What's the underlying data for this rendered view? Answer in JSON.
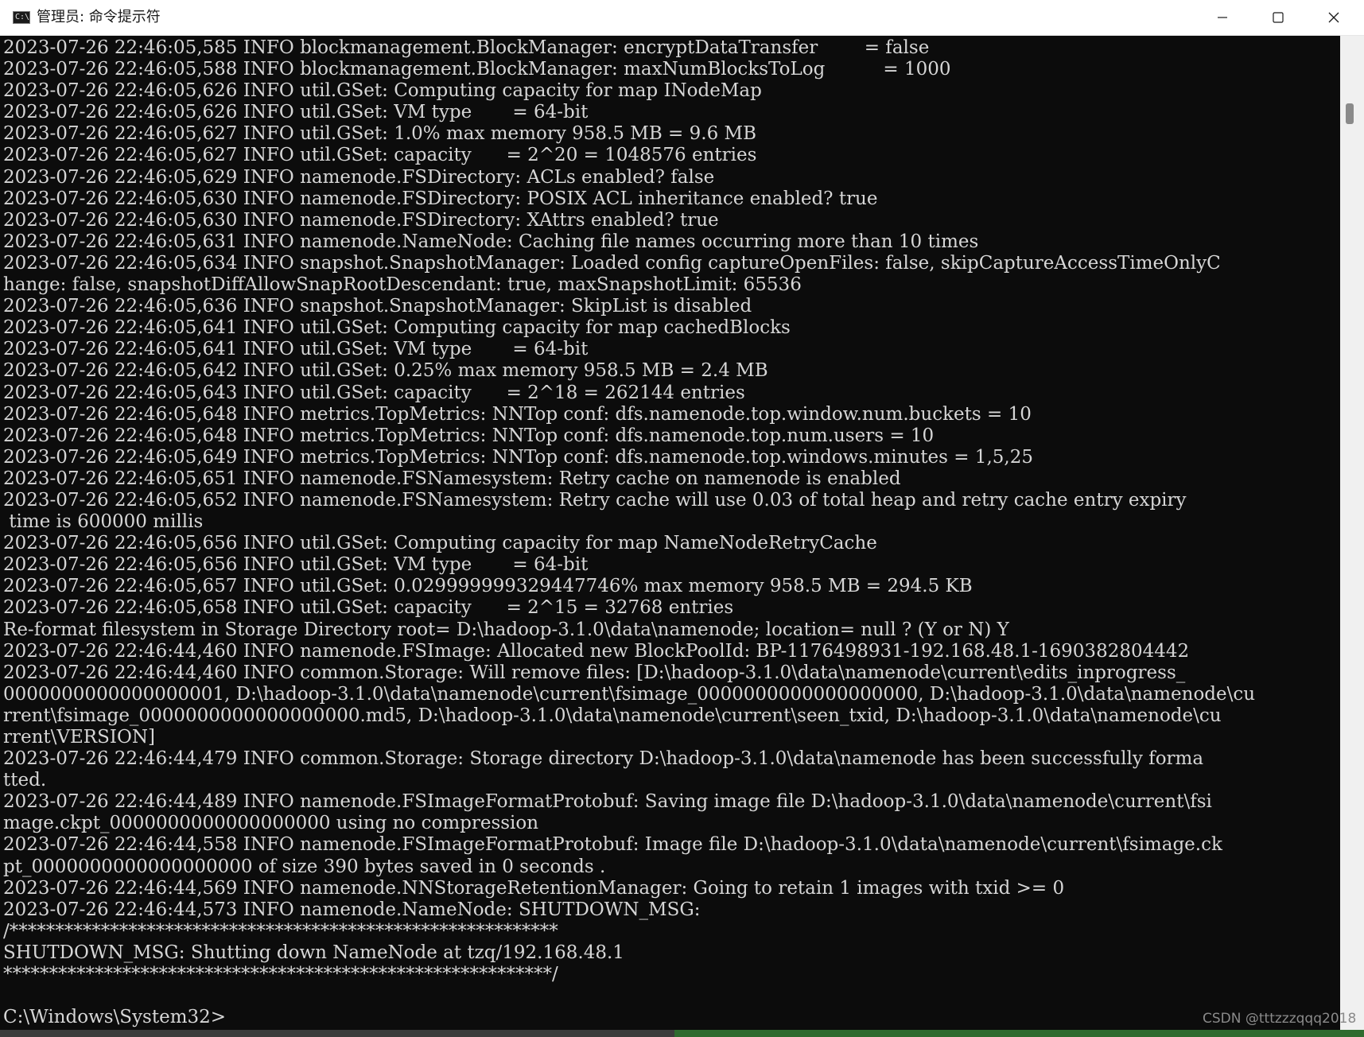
{
  "window": {
    "title": "管理员: 命令提示符",
    "icon": "cmd-icon",
    "controls": [
      "minimize-icon",
      "maximize-icon",
      "close-icon"
    ]
  },
  "console": {
    "background": "#0c0c0c",
    "foreground": "#d6d6d6",
    "lines": [
      "2023-07-26 22:46:05,585 INFO blockmanagement.BlockManager: encryptDataTransfer        = false",
      "2023-07-26 22:46:05,588 INFO blockmanagement.BlockManager: maxNumBlocksToLog          = 1000",
      "2023-07-26 22:46:05,626 INFO util.GSet: Computing capacity for map INodeMap",
      "2023-07-26 22:46:05,626 INFO util.GSet: VM type       = 64-bit",
      "2023-07-26 22:46:05,627 INFO util.GSet: 1.0% max memory 958.5 MB = 9.6 MB",
      "2023-07-26 22:46:05,627 INFO util.GSet: capacity      = 2^20 = 1048576 entries",
      "2023-07-26 22:46:05,629 INFO namenode.FSDirectory: ACLs enabled? false",
      "2023-07-26 22:46:05,630 INFO namenode.FSDirectory: POSIX ACL inheritance enabled? true",
      "2023-07-26 22:46:05,630 INFO namenode.FSDirectory: XAttrs enabled? true",
      "2023-07-26 22:46:05,631 INFO namenode.NameNode: Caching file names occurring more than 10 times",
      "2023-07-26 22:46:05,634 INFO snapshot.SnapshotManager: Loaded config captureOpenFiles: false, skipCaptureAccessTimeOnlyC",
      "hange: false, snapshotDiffAllowSnapRootDescendant: true, maxSnapshotLimit: 65536",
      "2023-07-26 22:46:05,636 INFO snapshot.SnapshotManager: SkipList is disabled",
      "2023-07-26 22:46:05,641 INFO util.GSet: Computing capacity for map cachedBlocks",
      "2023-07-26 22:46:05,641 INFO util.GSet: VM type       = 64-bit",
      "2023-07-26 22:46:05,642 INFO util.GSet: 0.25% max memory 958.5 MB = 2.4 MB",
      "2023-07-26 22:46:05,643 INFO util.GSet: capacity      = 2^18 = 262144 entries",
      "2023-07-26 22:46:05,648 INFO metrics.TopMetrics: NNTop conf: dfs.namenode.top.window.num.buckets = 10",
      "2023-07-26 22:46:05,648 INFO metrics.TopMetrics: NNTop conf: dfs.namenode.top.num.users = 10",
      "2023-07-26 22:46:05,649 INFO metrics.TopMetrics: NNTop conf: dfs.namenode.top.windows.minutes = 1,5,25",
      "2023-07-26 22:46:05,651 INFO namenode.FSNamesystem: Retry cache on namenode is enabled",
      "2023-07-26 22:46:05,652 INFO namenode.FSNamesystem: Retry cache will use 0.03 of total heap and retry cache entry expiry",
      " time is 600000 millis",
      "2023-07-26 22:46:05,656 INFO util.GSet: Computing capacity for map NameNodeRetryCache",
      "2023-07-26 22:46:05,656 INFO util.GSet: VM type       = 64-bit",
      "2023-07-26 22:46:05,657 INFO util.GSet: 0.029999999329447746% max memory 958.5 MB = 294.5 KB",
      "2023-07-26 22:46:05,658 INFO util.GSet: capacity      = 2^15 = 32768 entries",
      "Re-format filesystem in Storage Directory root= D:\\hadoop-3.1.0\\data\\namenode; location= null ? (Y or N) Y",
      "2023-07-26 22:46:44,460 INFO namenode.FSImage: Allocated new BlockPoolId: BP-1176498931-192.168.48.1-1690382804442",
      "2023-07-26 22:46:44,460 INFO common.Storage: Will remove files: [D:\\hadoop-3.1.0\\data\\namenode\\current\\edits_inprogress_",
      "0000000000000000001, D:\\hadoop-3.1.0\\data\\namenode\\current\\fsimage_0000000000000000000, D:\\hadoop-3.1.0\\data\\namenode\\cu",
      "rrent\\fsimage_0000000000000000000.md5, D:\\hadoop-3.1.0\\data\\namenode\\current\\seen_txid, D:\\hadoop-3.1.0\\data\\namenode\\cu",
      "rrent\\VERSION]",
      "2023-07-26 22:46:44,479 INFO common.Storage: Storage directory D:\\hadoop-3.1.0\\data\\namenode has been successfully forma",
      "tted.",
      "2023-07-26 22:46:44,489 INFO namenode.FSImageFormatProtobuf: Saving image file D:\\hadoop-3.1.0\\data\\namenode\\current\\fsi",
      "mage.ckpt_0000000000000000000 using no compression",
      "2023-07-26 22:46:44,558 INFO namenode.FSImageFormatProtobuf: Image file D:\\hadoop-3.1.0\\data\\namenode\\current\\fsimage.ck",
      "pt_0000000000000000000 of size 390 bytes saved in 0 seconds .",
      "2023-07-26 22:46:44,569 INFO namenode.NNStorageRetentionManager: Going to retain 1 images with txid >= 0",
      "2023-07-26 22:46:44,573 INFO namenode.NameNode: SHUTDOWN_MSG:",
      "/************************************************************",
      "SHUTDOWN_MSG: Shutting down NameNode at tzq/192.168.48.1",
      "************************************************************/",
      "",
      "C:\\Windows\\System32>"
    ]
  },
  "watermark": "CSDN @tttzzzqqq2018"
}
